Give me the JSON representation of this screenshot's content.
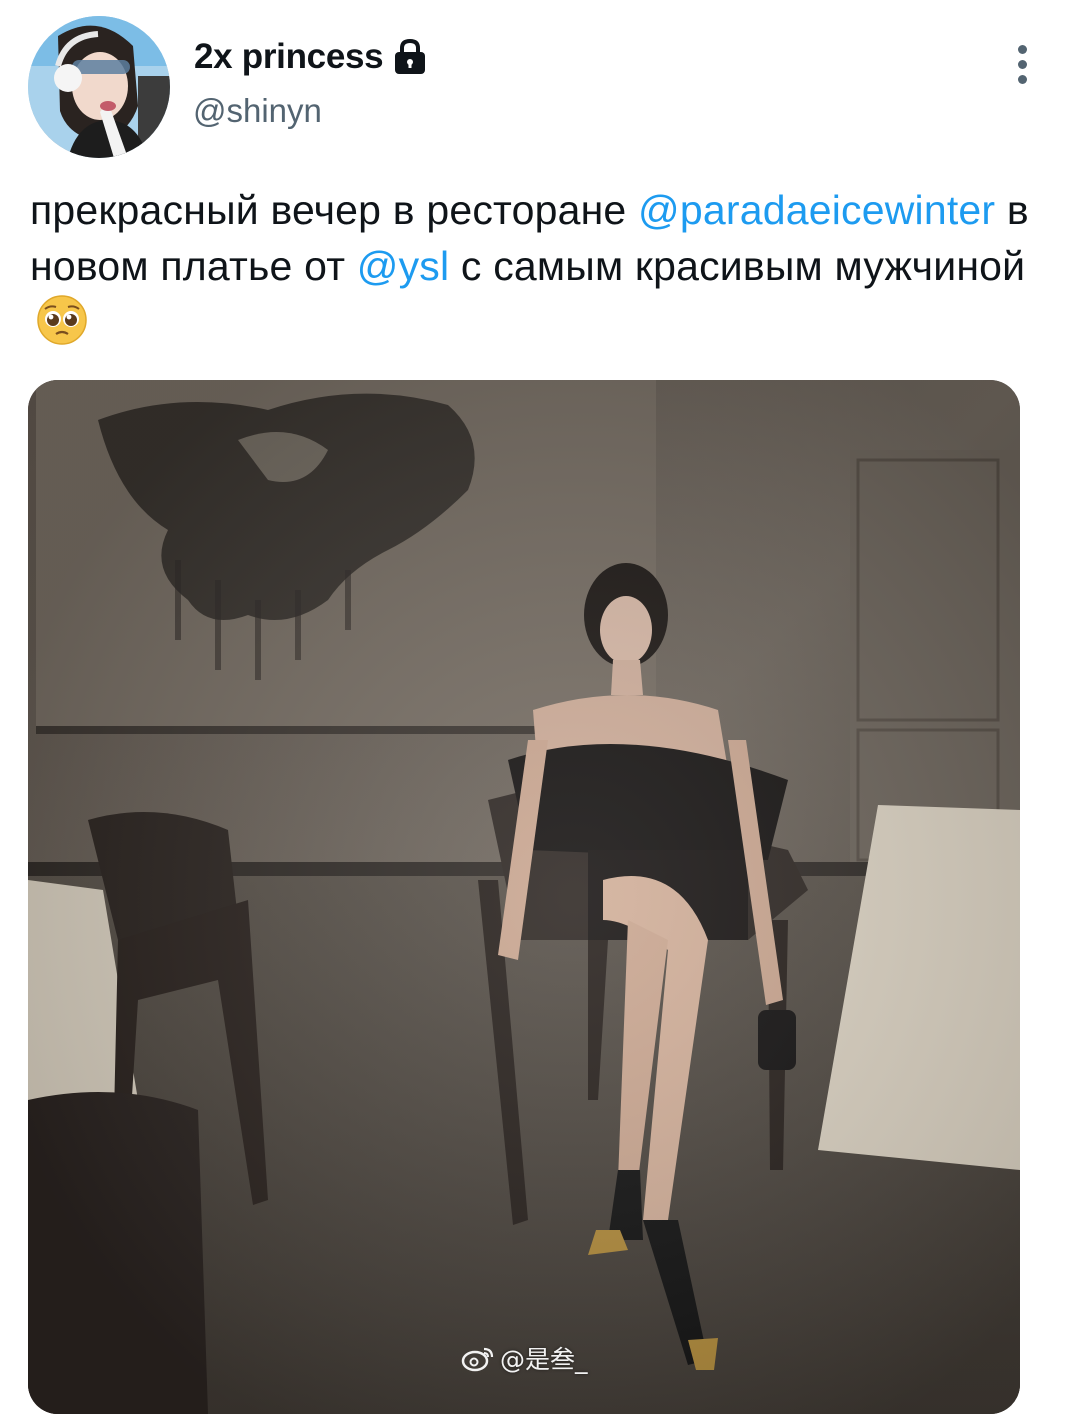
{
  "user": {
    "display_name": "2x princess",
    "handle": "@shinyn",
    "protected_icon": "lock-icon",
    "avatar_icon": "avatar"
  },
  "menu": {
    "icon": "more-vertical-icon"
  },
  "tweet": {
    "text_part1": "прекрасный вечер в ресторане ",
    "mention1": "@paradaeicewinter",
    "text_part2": " в новом платье от ",
    "mention2": "@ysl",
    "text_part3": " с самым красивым мужчиной",
    "emoji": "pleading-face-emoji"
  },
  "media": {
    "watermark_text": "@是叁_",
    "watermark_icon": "weibo-icon"
  },
  "colors": {
    "link": "#1d9bf0",
    "secondary_text": "#536471",
    "primary_text": "#0f1419"
  }
}
